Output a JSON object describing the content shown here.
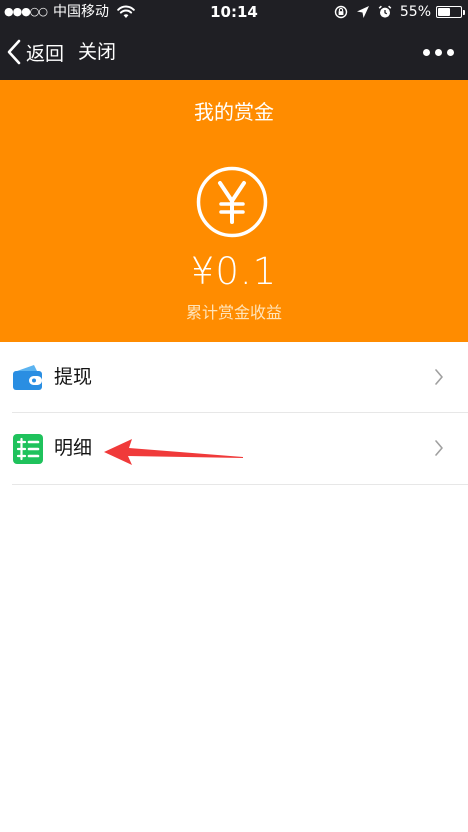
{
  "status_bar": {
    "signal": "●●●○○",
    "carrier": "中国移动",
    "time": "10:14",
    "battery_percent": "55%",
    "battery_level": 0.55
  },
  "nav": {
    "back_label": "返回",
    "close_label": "关闭"
  },
  "header": {
    "title": "我的赏金",
    "amount": "¥0.1",
    "caption": "累计赏金收益",
    "background_color": "#ff8c00"
  },
  "list": {
    "items": [
      {
        "label": "提现",
        "icon": "wallet-icon"
      },
      {
        "label": "明细",
        "icon": "ledger-icon"
      }
    ]
  },
  "annotation": {
    "arrow_color": "#f03a3a"
  }
}
